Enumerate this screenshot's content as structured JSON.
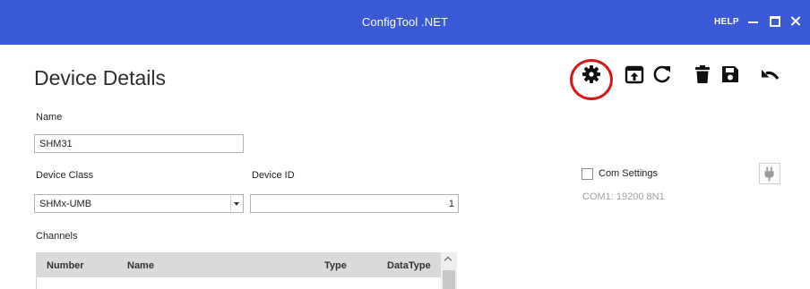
{
  "window": {
    "title": "ConfigTool .NET",
    "help": "HELP",
    "accent_color": "#3b5bd6"
  },
  "page": {
    "title": "Device Details"
  },
  "toolbar": {
    "buttons": [
      "gear-icon",
      "upload-icon",
      "refresh-icon",
      "trash-icon",
      "save-icon",
      "undo-icon"
    ],
    "highlight_color": "#d21818"
  },
  "form": {
    "name_label": "Name",
    "name_value": "SHM31",
    "device_class_label": "Device Class",
    "device_class_value": "SHMx-UMB",
    "device_id_label": "Device ID",
    "device_id_value": "1",
    "channels_label": "Channels"
  },
  "com": {
    "label": "Com Settings",
    "checked": false,
    "info": "COM1: 19200 8N1"
  },
  "channels_table": {
    "columns": [
      "Number",
      "Name",
      "Type",
      "DataType"
    ]
  }
}
